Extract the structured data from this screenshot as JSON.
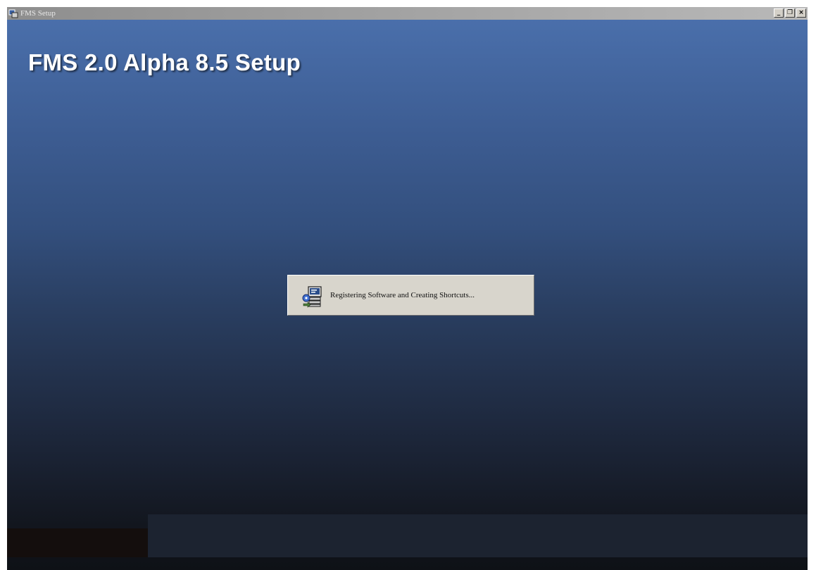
{
  "window": {
    "title": "FMS Setup",
    "controls": {
      "minimize": "_",
      "restore": "❐",
      "close": "×"
    }
  },
  "setup": {
    "heading": "FMS 2.0 Alpha 8.5 Setup"
  },
  "progress_dialog": {
    "status_text": "Registering Software and Creating Shortcuts...",
    "icon": "installer-icon"
  },
  "colors": {
    "gradient_top": "#4a6fab",
    "gradient_bottom": "#0e1116",
    "dialog_bg": "#d8d5cc",
    "heading": "#ffffff"
  }
}
